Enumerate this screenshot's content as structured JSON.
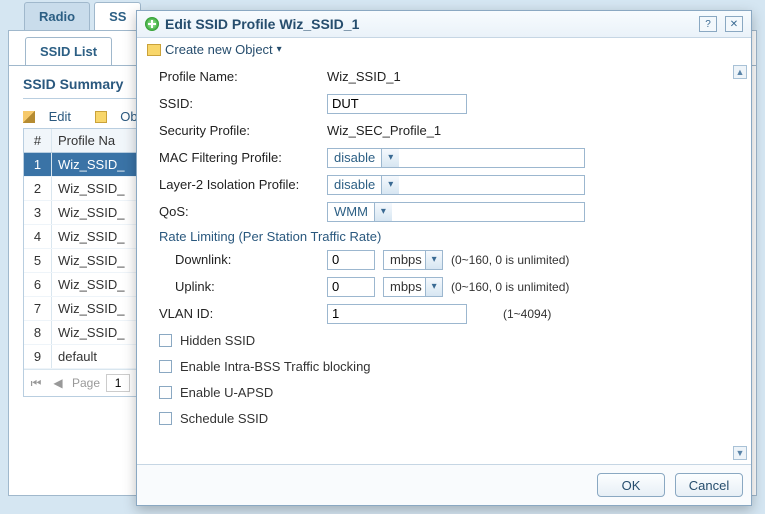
{
  "bg": {
    "tabs": {
      "radio": "Radio",
      "ssid": "SS"
    },
    "subtab": "SSID List",
    "summaryTitle": "SSID Summary",
    "toolbar": {
      "edit": "Edit",
      "obj": "Obje"
    },
    "headers": {
      "num": "#",
      "name": "Profile Na"
    },
    "rows": [
      {
        "num": "1",
        "name": "Wiz_SSID_"
      },
      {
        "num": "2",
        "name": "Wiz_SSID_"
      },
      {
        "num": "3",
        "name": "Wiz_SSID_"
      },
      {
        "num": "4",
        "name": "Wiz_SSID_"
      },
      {
        "num": "5",
        "name": "Wiz_SSID_"
      },
      {
        "num": "6",
        "name": "Wiz_SSID_"
      },
      {
        "num": "7",
        "name": "Wiz_SSID_"
      },
      {
        "num": "8",
        "name": "Wiz_SSID_"
      },
      {
        "num": "9",
        "name": "default"
      }
    ],
    "pager": {
      "label": "Page",
      "value": "1"
    }
  },
  "modal": {
    "title": "Edit SSID Profile Wiz_SSID_1",
    "createObj": "Create new Object",
    "labels": {
      "profileName": "Profile Name:",
      "ssid": "SSID:",
      "secProfile": "Security Profile:",
      "macFilter": "MAC Filtering Profile:",
      "l2iso": "Layer-2 Isolation Profile:",
      "qos": "QoS:",
      "rateLimit": "Rate Limiting (Per Station Traffic Rate)",
      "downlink": "Downlink:",
      "uplink": "Uplink:",
      "vlan": "VLAN ID:",
      "hidden": "Hidden SSID",
      "intra": "Enable Intra-BSS Traffic blocking",
      "uapsd": "Enable U-APSD",
      "schedule": "Schedule SSID"
    },
    "values": {
      "profileName": "Wiz_SSID_1",
      "ssid": "DUT",
      "secProfile": "Wiz_SEC_Profile_1",
      "macFilter": "disable",
      "l2iso": "disable",
      "qos": "WMM",
      "downlink": "0",
      "downlinkUnit": "mbps",
      "uplink": "0",
      "uplinkUnit": "mbps",
      "vlan": "1"
    },
    "hints": {
      "rate": "(0~160, 0 is unlimited)",
      "vlan": "(1~4094)"
    },
    "buttons": {
      "ok": "OK",
      "cancel": "Cancel"
    }
  }
}
